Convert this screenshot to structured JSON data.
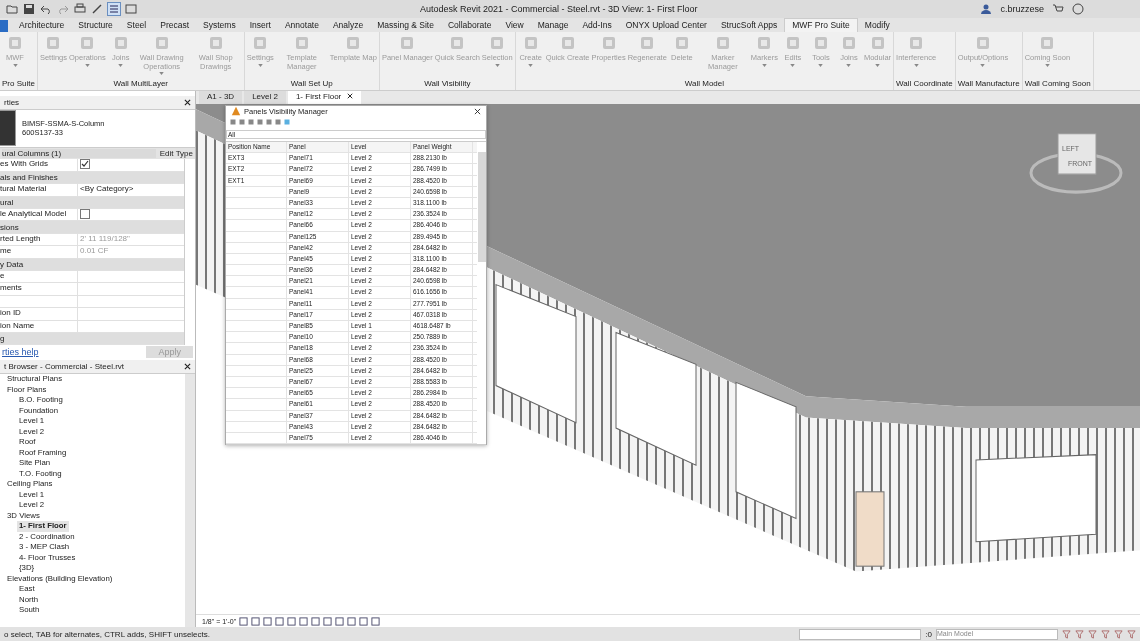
{
  "window": {
    "title": "Autodesk Revit 2021 - Commercial - Steel.rvt - 3D View: 1- First Floor",
    "user": "c.bruzzese"
  },
  "menu_tabs": [
    {
      "label": "Architecture",
      "selected": false
    },
    {
      "label": "Structure",
      "selected": false
    },
    {
      "label": "Steel",
      "selected": false
    },
    {
      "label": "Precast",
      "selected": false
    },
    {
      "label": "Systems",
      "selected": false
    },
    {
      "label": "Insert",
      "selected": false
    },
    {
      "label": "Annotate",
      "selected": false
    },
    {
      "label": "Analyze",
      "selected": false
    },
    {
      "label": "Massing & Site",
      "selected": false
    },
    {
      "label": "Collaborate",
      "selected": false
    },
    {
      "label": "View",
      "selected": false
    },
    {
      "label": "Manage",
      "selected": false
    },
    {
      "label": "Add-Ins",
      "selected": false
    },
    {
      "label": "ONYX Upload Center",
      "selected": false
    },
    {
      "label": "StrucSoft Apps",
      "selected": false
    },
    {
      "label": "MWF Pro Suite",
      "selected": true
    },
    {
      "label": "Modify",
      "selected": false
    }
  ],
  "ribbon": {
    "groups": [
      {
        "label": "Pro Suite",
        "tools": [
          {
            "label": "MWF",
            "dropdown": true
          }
        ]
      },
      {
        "label": "Wall MultiLayer",
        "tools": [
          {
            "label": "Settings",
            "dropdown": false
          },
          {
            "label": "Operations",
            "dropdown": true
          },
          {
            "label": "Joins",
            "dropdown": true
          },
          {
            "label": "Wall Drawing Operations",
            "dropdown": true
          },
          {
            "label": "Wall Shop Drawings",
            "dropdown": false
          }
        ]
      },
      {
        "label": "Wall Set Up",
        "tools": [
          {
            "label": "Settings",
            "dropdown": true
          },
          {
            "label": "Template Manager",
            "dropdown": false
          },
          {
            "label": "Template Map",
            "dropdown": false
          }
        ]
      },
      {
        "label": "Wall Visibility",
        "tools": [
          {
            "label": "Panel Manager",
            "dropdown": false
          },
          {
            "label": "Quick Search",
            "dropdown": false
          },
          {
            "label": "Selection",
            "dropdown": true
          }
        ]
      },
      {
        "label": "Wall Model",
        "tools": [
          {
            "label": "Create",
            "dropdown": true
          },
          {
            "label": "Quick Create",
            "dropdown": false
          },
          {
            "label": "Properties",
            "dropdown": false
          },
          {
            "label": "Regenerate",
            "dropdown": false
          },
          {
            "label": "Delete",
            "dropdown": false
          },
          {
            "label": "Marker Manager",
            "dropdown": false
          },
          {
            "label": "Markers",
            "dropdown": true
          },
          {
            "label": "Edits",
            "dropdown": true
          },
          {
            "label": "Tools",
            "dropdown": true
          },
          {
            "label": "Joins",
            "dropdown": true
          },
          {
            "label": "Modular",
            "dropdown": true
          }
        ]
      },
      {
        "label": "Wall Coordinate",
        "tools": [
          {
            "label": "Interference",
            "dropdown": true
          }
        ]
      },
      {
        "label": "Wall Manufacture",
        "tools": [
          {
            "label": "Output/Options",
            "dropdown": true
          }
        ]
      },
      {
        "label": "Wall Coming Soon",
        "tools": [
          {
            "label": "Coming Soon",
            "dropdown": true
          }
        ]
      }
    ]
  },
  "properties": {
    "title": "rties",
    "type_name": "BIMSF-SSMA-S-Column",
    "type_size": "600S137-33",
    "filter": "ural Columns (1)",
    "edit_type": "Edit Type",
    "rows": [
      {
        "kind": "check",
        "label": "es With Grids",
        "checked": true
      },
      {
        "kind": "group",
        "label": "als and Finishes"
      },
      {
        "kind": "text",
        "label": "tural Material",
        "value": "<By Category>",
        "disabled": false
      },
      {
        "kind": "group",
        "label": "ural"
      },
      {
        "kind": "check",
        "label": "le Analytical Model",
        "checked": false
      },
      {
        "kind": "group",
        "label": "sions"
      },
      {
        "kind": "text",
        "label": "rted Length",
        "value": "2'  11 119/128\"",
        "disabled": true
      },
      {
        "kind": "text",
        "label": "me",
        "value": "0.01 CF",
        "disabled": true
      },
      {
        "kind": "group",
        "label": "y Data"
      },
      {
        "kind": "text",
        "label": "e"
      },
      {
        "kind": "text",
        "label": "ments"
      },
      {
        "kind": "text"
      },
      {
        "kind": "text",
        "label": "ion ID"
      },
      {
        "kind": "text",
        "label": "ion Name"
      },
      {
        "kind": "group",
        "label": "g"
      }
    ],
    "help_link": "rties help",
    "apply": "Apply"
  },
  "project_browser": {
    "title": "t Browser - Commercial - Steel.rvt",
    "items": [
      {
        "label": "Structural Plans",
        "selected": false
      },
      {
        "label": "Floor Plans",
        "selected": false,
        "children": [
          {
            "label": "B.O. Footing",
            "selected": false
          },
          {
            "label": "Foundation",
            "selected": false
          },
          {
            "label": "Level 1",
            "selected": false
          },
          {
            "label": "Level 2",
            "selected": false
          },
          {
            "label": "Roof",
            "selected": false
          },
          {
            "label": "Roof Framing",
            "selected": false
          },
          {
            "label": "Site Plan",
            "selected": false
          },
          {
            "label": "T.O. Footing",
            "selected": false
          }
        ]
      },
      {
        "label": "Ceiling Plans",
        "selected": false,
        "children": [
          {
            "label": "Level 1",
            "selected": false
          },
          {
            "label": "Level 2",
            "selected": false
          }
        ]
      },
      {
        "label": "3D Views",
        "selected": false,
        "children": [
          {
            "label": "1- First Floor",
            "selected": true
          },
          {
            "label": "2 - Coordination",
            "selected": false
          },
          {
            "label": "3 - MEP Clash",
            "selected": false
          },
          {
            "label": "4- Floor Trusses",
            "selected": false
          },
          {
            "label": "{3D}",
            "selected": false
          }
        ]
      },
      {
        "label": "Elevations (Building Elevation)",
        "selected": false,
        "children": [
          {
            "label": "East",
            "selected": false
          },
          {
            "label": "North",
            "selected": false
          },
          {
            "label": "South",
            "selected": false
          }
        ]
      }
    ]
  },
  "view_tabs": [
    {
      "label": "A1 - 3D",
      "selected": false
    },
    {
      "label": "Level 2",
      "selected": false
    },
    {
      "label": "1- First Floor",
      "selected": true
    }
  ],
  "view_cube": {
    "faces": [
      "LEFT",
      "FRONT"
    ]
  },
  "dialog": {
    "title": "Panels Visibility Manager",
    "filter": "All",
    "columns": [
      "Position Name",
      "Panel",
      "Level",
      "Panel Weight"
    ],
    "rows": [
      [
        "EXT3",
        "Panel71",
        "Level 2",
        "288.2130 lb"
      ],
      [
        "EXT2",
        "Panel72",
        "Level 2",
        "286.7499 lb"
      ],
      [
        "EXT1",
        "Panel69",
        "Level 2",
        "288.4520 lb"
      ],
      [
        "",
        "Panel9",
        "Level 2",
        "240.6598 lb"
      ],
      [
        "",
        "Panel33",
        "Level 2",
        "318.1100 lb"
      ],
      [
        "",
        "Panel12",
        "Level 2",
        "236.3524 lb"
      ],
      [
        "",
        "Panel66",
        "Level 2",
        "286.4046 lb"
      ],
      [
        "",
        "Panel125",
        "Level 2",
        "289.4945 lb"
      ],
      [
        "",
        "Panel42",
        "Level 2",
        "284.6482 lb"
      ],
      [
        "",
        "Panel45",
        "Level 2",
        "318.1100 lb"
      ],
      [
        "",
        "Panel36",
        "Level 2",
        "284.6482 lb"
      ],
      [
        "",
        "Panel21",
        "Level 2",
        "240.6598 lb"
      ],
      [
        "",
        "Panel41",
        "Level 2",
        "616.1656 lb"
      ],
      [
        "",
        "Panel11",
        "Level 2",
        "277.7951 lb"
      ],
      [
        "",
        "Panel17",
        "Level 2",
        "467.0318 lb"
      ],
      [
        "",
        "Panel85",
        "Level 1",
        "4618.6487 lb"
      ],
      [
        "",
        "Panel10",
        "Level 2",
        "250.7889 lb"
      ],
      [
        "",
        "Panel18",
        "Level 2",
        "236.3524 lb"
      ],
      [
        "",
        "Panel68",
        "Level 2",
        "288.4520 lb"
      ],
      [
        "",
        "Panel25",
        "Level 2",
        "284.6482 lb"
      ],
      [
        "",
        "Panel67",
        "Level 2",
        "288.5583 lb"
      ],
      [
        "",
        "Panel65",
        "Level 2",
        "286.2984 lb"
      ],
      [
        "",
        "Panel61",
        "Level 2",
        "288.4520 lb"
      ],
      [
        "",
        "Panel37",
        "Level 2",
        "284.6482 lb"
      ],
      [
        "",
        "Panel43",
        "Level 2",
        "284.6482 lb"
      ],
      [
        "",
        "Panel75",
        "Level 2",
        "286.4046 lb"
      ]
    ]
  },
  "view_bar": {
    "scale": "1/8\" = 1'-0\""
  },
  "status_bar": {
    "message": "o select, TAB for alternates, CTRL adds, SHIFT unselects.",
    "count": ":0",
    "model": "Main Model"
  }
}
